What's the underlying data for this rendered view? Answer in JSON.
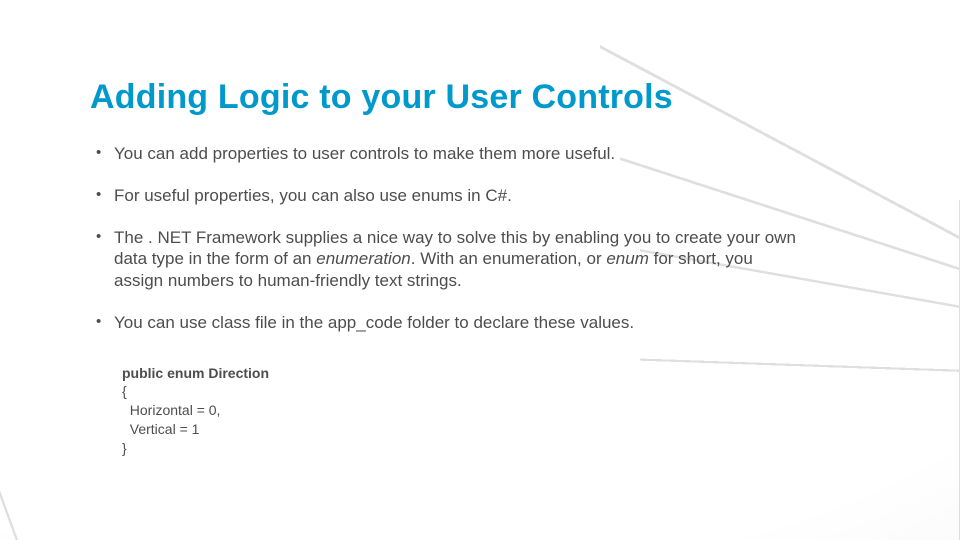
{
  "title": "Adding Logic to your User Controls",
  "bullets": {
    "b0": "You can add properties to user controls to make them more useful.",
    "b1": "For useful properties, you can also use enums in C#.",
    "b2a": "The . NET Framework supplies a nice way to solve this by enabling you to create your own data type in the form of an ",
    "b2_em1": "enumeration",
    "b2b": ". With an enumeration, or ",
    "b2_em2": "enum ",
    "b2c": "for short, you assign numbers to human-friendly text strings.",
    "b3": "You can use  class file in the app_code folder to declare these values."
  },
  "code": {
    "l1a": "public enum ",
    "l1b": "Direction",
    "l2": "{",
    "l3": "  Horizontal = 0,",
    "l4": "  Vertical = 1",
    "l5": "}"
  }
}
